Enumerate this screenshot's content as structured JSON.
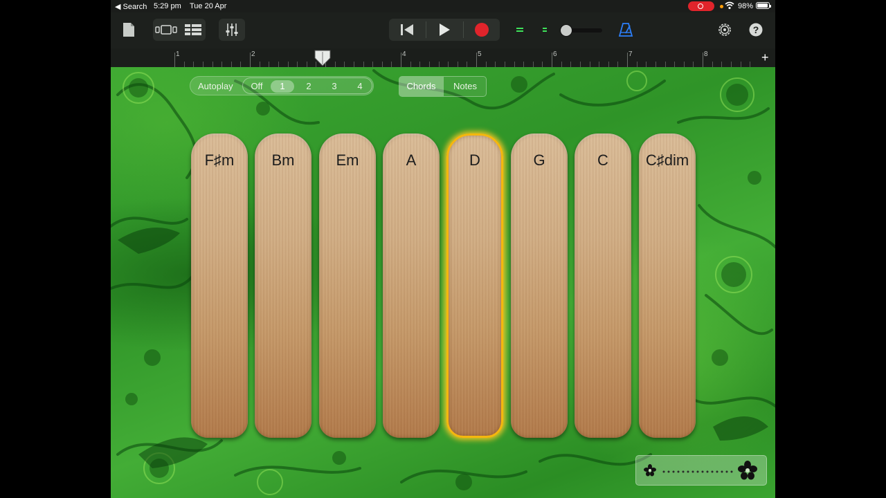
{
  "status_bar": {
    "back_label": "Search",
    "time": "5:29 pm",
    "date": "Tue 20 Apr",
    "battery": "98%"
  },
  "toolbar": {
    "icons": [
      "my-songs-icon",
      "browser-icon",
      "tracks-view-icon",
      "mixer-icon",
      "go-to-beginning-icon",
      "play-icon",
      "record-icon",
      "metronome-icon",
      "settings-icon",
      "help-icon"
    ]
  },
  "ruler": {
    "bars": [
      "1",
      "2",
      "3",
      "4",
      "5",
      "6",
      "7",
      "8"
    ],
    "add_label": "+"
  },
  "autoplay": {
    "label": "Autoplay",
    "options": [
      "Off",
      "1",
      "2",
      "3",
      "4"
    ],
    "selected": "1"
  },
  "mode": {
    "chords_label": "Chords",
    "notes_label": "Notes",
    "selected": "Chords"
  },
  "chords": [
    {
      "label": "F♯m",
      "active": false
    },
    {
      "label": "Bm",
      "active": false
    },
    {
      "label": "Em",
      "active": false
    },
    {
      "label": "A",
      "active": false
    },
    {
      "label": "D",
      "active": true
    },
    {
      "label": "G",
      "active": false
    },
    {
      "label": "C",
      "active": false
    },
    {
      "label": "C♯dim",
      "active": false
    }
  ],
  "colors": {
    "background_green": "#3ca632",
    "record_red": "#e0242b",
    "active_outline": "#f5b70e",
    "metronome_blue": "#2d7ff9"
  }
}
